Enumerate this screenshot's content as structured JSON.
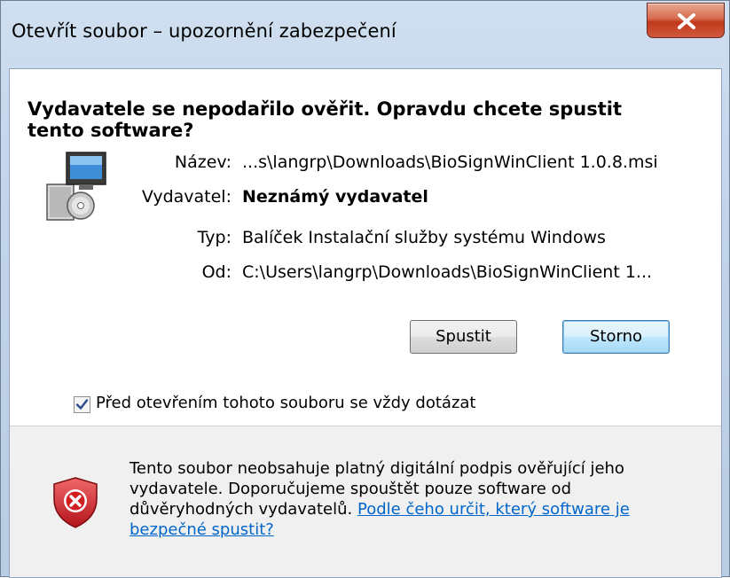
{
  "window": {
    "title": "Otevřít soubor – upozornění zabezpečení",
    "close_icon": "close-x-icon"
  },
  "dialog": {
    "heading": "Vydavatele se nepodařilo ověřit. Opravdu chcete spustit tento software?",
    "app_icon": "installer-package-icon",
    "properties": [
      {
        "label": "Název:",
        "value": "...s\\langrp\\Downloads\\BioSignWinClient 1.0.8.msi"
      },
      {
        "label": "Vydavatel:",
        "value": "Neznámý vydavatel"
      },
      {
        "label": "Typ:",
        "value": "Balíček Instalační služby systému Windows"
      },
      {
        "label": "Od:",
        "value": "C:\\Users\\langrp\\Downloads\\BioSignWinClient 1..."
      }
    ],
    "buttons": {
      "run": "Spustit",
      "cancel": "Storno"
    },
    "checkbox": {
      "label": "Před otevřením tohoto souboru se vždy dotázat",
      "checked": true
    }
  },
  "footer": {
    "shield_icon": "security-warning-shield-icon",
    "text": "Tento soubor neobsahuje platný digitální podpis ověřující jeho vydavatele. Doporučujeme spouštět pouze software od důvěryhodných vydavatelů.",
    "link": "Podle čeho určit, který software je bezpečné spustit?"
  }
}
